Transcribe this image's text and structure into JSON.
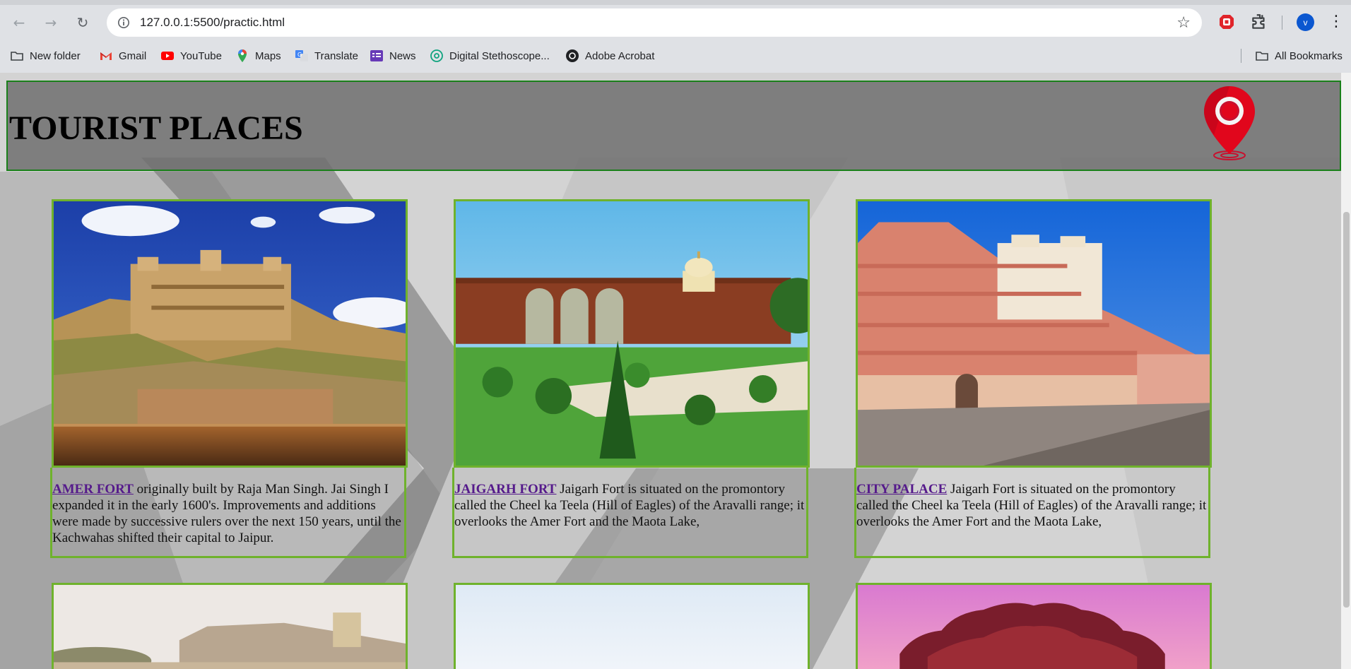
{
  "browser": {
    "url": "127.0.0.1:5500/practic.html",
    "bookmarks": [
      {
        "label": "New folder",
        "icon": "folder-icon"
      },
      {
        "label": "Gmail",
        "icon": "gmail-icon"
      },
      {
        "label": "YouTube",
        "icon": "youtube-icon"
      },
      {
        "label": "Maps",
        "icon": "maps-icon"
      },
      {
        "label": "Translate",
        "icon": "translate-icon"
      },
      {
        "label": "News",
        "icon": "news-icon"
      },
      {
        "label": "Digital Stethoscope...",
        "icon": "stethoscope-icon"
      },
      {
        "label": "Adobe Acrobat",
        "icon": "acrobat-icon"
      }
    ],
    "all_bookmarks_label": "All Bookmarks",
    "profile_initial": "v",
    "colors": {
      "accent": "#0b57d0",
      "chrome": "#dfe1e5"
    }
  },
  "page": {
    "title": "TOURIST PLACES",
    "border_color": "#6fb22c",
    "cards": [
      {
        "image": "amer-fort-photo",
        "link": "AMER FORT",
        "text": " originally built by Raja Man Singh. Jai Singh I expanded it in the early 1600's. Improvements and additions were made by successive rulers over the next 150 years, until the Kachwahas shifted their capital to Jaipur."
      },
      {
        "image": "jaigarh-fort-photo",
        "link": "JAIGARH FORT",
        "text": " Jaigarh Fort is situated on the promontory called the Cheel ka Teela (Hill of Eagles) of the Aravalli range; it overlooks the Amer Fort and the Maota Lake,"
      },
      {
        "image": "city-palace-photo",
        "link": "CITY PALACE",
        "text": " Jaigarh Fort is situated on the promontory called the Cheel ka Teela (Hill of Eagles) of the Aravalli range; it overlooks the Amer Fort and the Maota Lake,"
      }
    ],
    "second_row_images": [
      "hill-fort-photo",
      "hazy-sky-photo",
      "hawa-mahal-photo"
    ]
  }
}
